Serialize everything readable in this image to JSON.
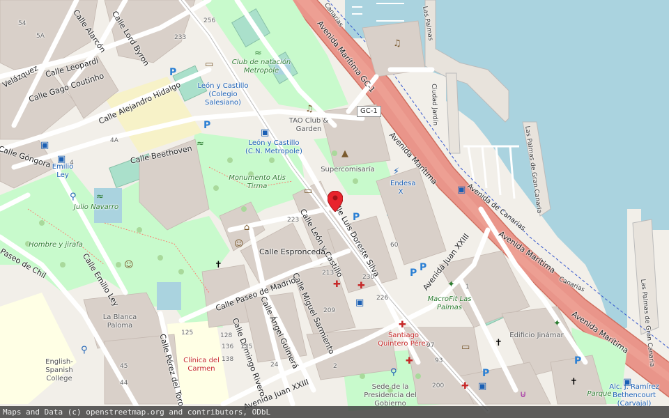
{
  "map": {
    "colors": {
      "background": "#f2efe9",
      "sea": "#aad3df",
      "park": "#c8facc",
      "garden": "#cdebb0",
      "building": "#d9d0c9",
      "motorway": "#e892a2",
      "trunk": "#f7a8a0",
      "pitch": "#aae0cb",
      "school": "#ffffe5"
    },
    "streets": {
      "avenida_maritima_gc1": "Avenida Marítima GC-1",
      "avenida_maritima_1": "Avenida Marítima",
      "avenida_maritima_2": "Avenida Marítima",
      "avenida_maritima_3": "Avenida Marítima",
      "avenida_canarias": "Avenida de Canarias",
      "canarias_fragment": "Canarias",
      "canarias_top": "Canarias",
      "gc1_shield": "GC-1",
      "calle_lord_byron": "Calle Lord Byron",
      "calle_alarcon": "Calle Alarcón",
      "calle_velazquez": "Velázquez",
      "calle_leopardi": "Calle Leopardi",
      "calle_gago_coutinho": "Calle Gago Coutinho",
      "calle_alejandro_hidalgo": "Calle Alejandro Hidalgo",
      "calle_beethoven": "Calle Beethoven",
      "calle_gongora": "Calle Góngora",
      "paseo_de_chil": "Paseo de Chil",
      "calle_emilio_ley": "Calle Emilio Ley",
      "calle_luis_doreste_silva": "Calle Luis Doreste Silva",
      "calle_leon_y_castillo": "Calle León y Castillo",
      "calle_espronceda": "Calle Espronceda",
      "calle_paseo_de_madrid": "Calle Paseo de Madrid",
      "calle_miguel_sarmiento": "Calle Miguel Sarmiento",
      "calle_angel_guimera": "Calle Ángel Guimerá",
      "calle_domingo_rivero": "Calle Domingo Rivero",
      "calle_perez_del_toro": "Calle Pérez del Toro",
      "avenida_juan_xxiii_1": "Avenida Juan XXIII",
      "avenida_juan_xxiii_2": "Avenida Juan XXIII",
      "ciudad_jardin": "Ciudad Jardín",
      "las_palmas_gc_1": "Las Palmas de Gran Canaria",
      "las_palmas_gc_2": "Las Palmas de Gran Canaria",
      "las_palmas_top": "Las Palmas"
    },
    "pois": {
      "club_natacion": "Club de natación Metropole",
      "leon_castillo_salesiano": "León y Castillo (Colegio Salesiano)",
      "tao_club": "TAO Club & Garden",
      "leon_castillo_metropole": "León y Castillo (C.N. Metropole)",
      "supercomisaria": "Supercomisaría",
      "endesa": "Endesa X",
      "monumento": "Monumento Atis Tirma",
      "emilio_ley": "Emilio Ley",
      "julio_navarro": "Julio Navarro",
      "hombre_jirafa": "Hombre y jirafa",
      "la_blanca_paloma": "La Blanca Paloma",
      "clinica_carmen": "Clínica del Carmen",
      "english_college": "English-Spanish College",
      "macrofit": "MacroFit Las Palmas",
      "santiago_quintero": "Santiago Quintero Pérez",
      "edificio_jinamar": "Edificio Jinámar",
      "sede_presidencia": "Sede de la Presidencia del Gobierno",
      "parque": "Parque",
      "alc_ramirez": "Alc. J. Ramírez Bethencourt (Carvajal)"
    },
    "house_numbers": [
      "256",
      "233",
      "54",
      "5A",
      "4A",
      "4",
      "14",
      "10",
      "12",
      "8",
      "60",
      "1",
      "97",
      "93",
      "200",
      "230",
      "226",
      "209",
      "213",
      "223",
      "215",
      "24",
      "2",
      "42",
      "48",
      "125",
      "128",
      "136",
      "138",
      "135",
      "45",
      "43",
      "44",
      "48",
      "2",
      "65",
      "2"
    ],
    "marker": {
      "label": "marker"
    }
  },
  "attribution": {
    "text": "Maps and Data (c) openstreetmap.org and contributors, ODbL"
  }
}
